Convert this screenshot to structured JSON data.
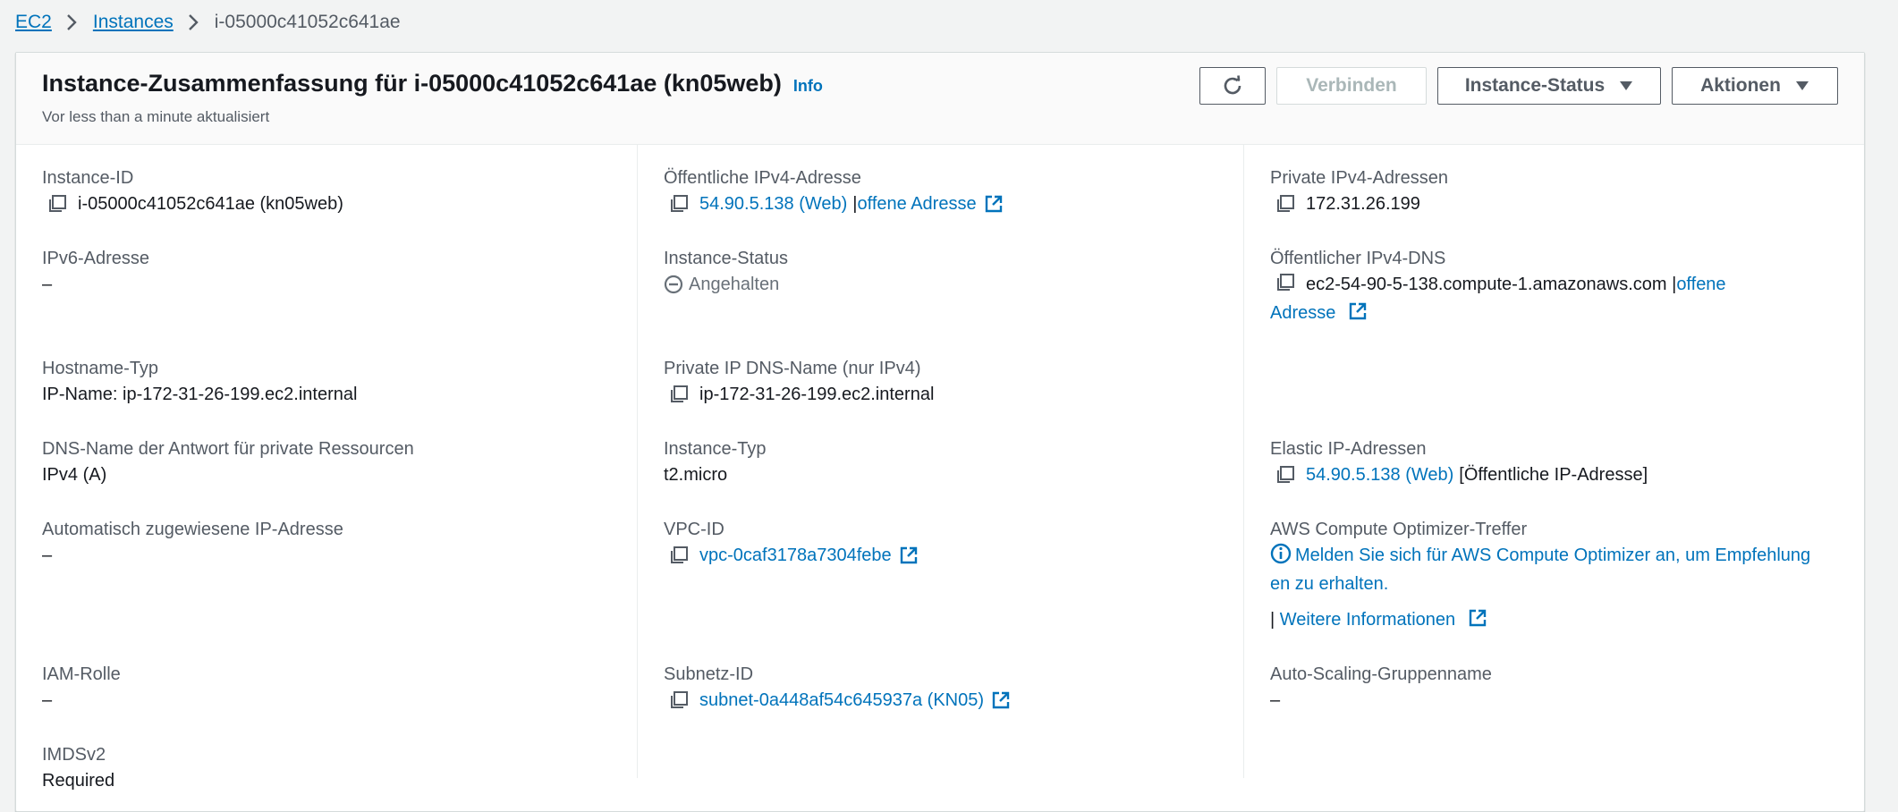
{
  "breadcrumb": {
    "ec2": "EC2",
    "instances": "Instances",
    "current": "i-05000c41052c641ae"
  },
  "header": {
    "title": "Instance-Zusammenfassung für i-05000c41052c641ae (kn05web)",
    "info": "Info",
    "subtitle": "Vor less than a minute aktualisiert",
    "buttons": {
      "refresh_icon": "refresh-icon",
      "connect": "Verbinden",
      "instance_state": "Instance-Status",
      "actions": "Aktionen"
    }
  },
  "fields": {
    "instance_id": {
      "label": "Instance-ID",
      "value": "i-05000c41052c641ae (kn05web)"
    },
    "public_ipv4": {
      "label": "Öffentliche IPv4-Adresse",
      "value": "54.90.5.138 (Web)",
      "sep": "|",
      "open": "offene Adresse"
    },
    "private_ipv4": {
      "label": "Private IPv4-Adressen",
      "value": "172.31.26.199"
    },
    "ipv6": {
      "label": "IPv6-Adresse",
      "value": "–"
    },
    "instance_state": {
      "label": "Instance-Status",
      "value": "Angehalten"
    },
    "public_dns": {
      "label": "Öffentlicher IPv4-DNS",
      "value": "ec2-54-90-5-138.compute-1.amazonaws.com",
      "sep": "|",
      "open1": "offene",
      "open2": "Adresse"
    },
    "hostname_type": {
      "label": "Hostname-Typ",
      "value": "IP-Name: ip-172-31-26-199.ec2.internal"
    },
    "private_dns": {
      "label": "Private IP DNS-Name (nur IPv4)",
      "value": "ip-172-31-26-199.ec2.internal"
    },
    "dns_answer": {
      "label": "DNS-Name der Antwort für private Ressourcen",
      "value": "IPv4 (A)"
    },
    "instance_type": {
      "label": "Instance-Typ",
      "value": "t2.micro"
    },
    "elastic_ip": {
      "label": "Elastic IP-Adressen",
      "value": "54.90.5.138 (Web)",
      "suffix": "[Öffentliche IP-Adresse]"
    },
    "auto_ip": {
      "label": "Automatisch zugewiesene IP-Adresse",
      "value": "–"
    },
    "vpc_id": {
      "label": "VPC-ID",
      "value": "vpc-0caf3178a7304febe"
    },
    "optimizer": {
      "label": "AWS Compute Optimizer-Treffer",
      "line1": "Melden Sie sich für AWS Compute Optimizer an, um Empfehlung",
      "line2": "en zu erhalten.",
      "sep": "|",
      "more": "Weitere Informationen"
    },
    "iam_role": {
      "label": "IAM-Rolle",
      "value": "–"
    },
    "subnet_id": {
      "label": "Subnetz-ID",
      "value": "subnet-0a448af54c645937a (KN05)"
    },
    "asg_name": {
      "label": "Auto-Scaling-Gruppenname",
      "value": "–"
    },
    "imdsv2": {
      "label": "IMDSv2",
      "value": "Required"
    }
  },
  "colors": {
    "link": "#0073bb",
    "label": "#545b64",
    "text": "#16191f",
    "stopped": "#687078"
  }
}
